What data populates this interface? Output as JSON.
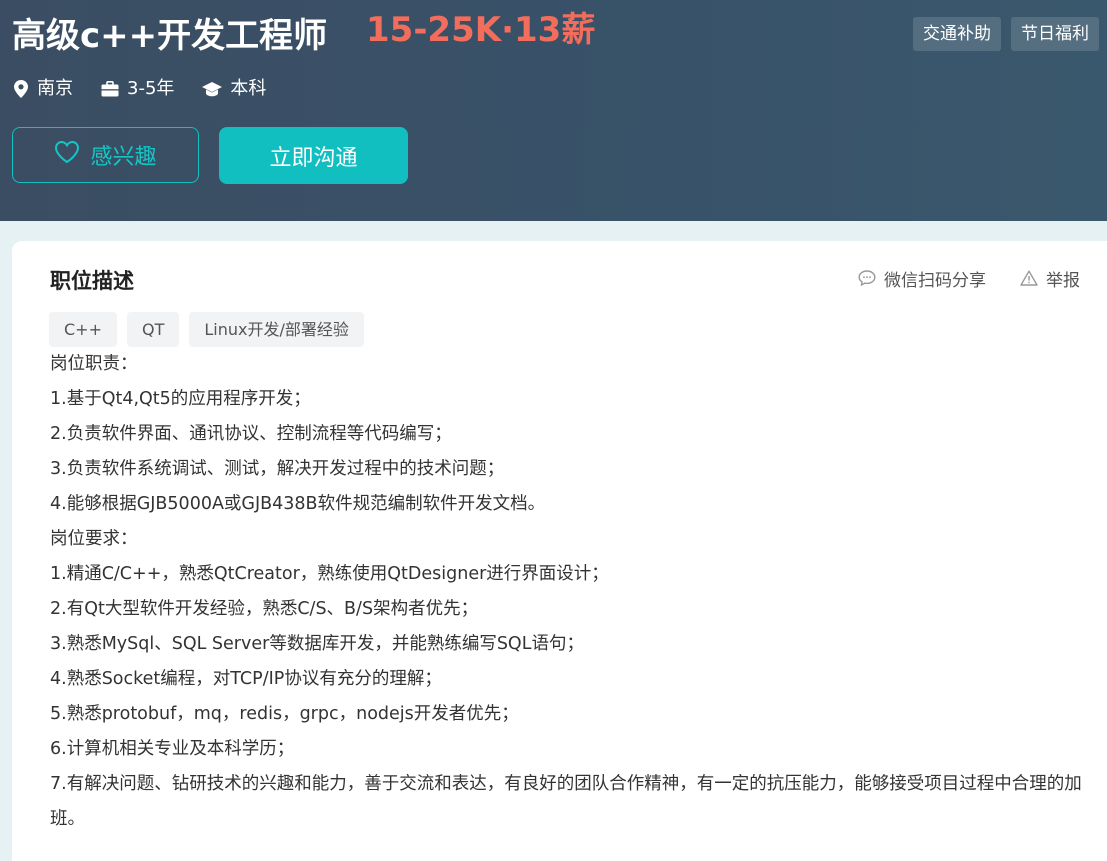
{
  "job": {
    "title": "高级c++开发工程师",
    "salary": "15-25K·13薪",
    "benefits": [
      "交通补助",
      "节日福利"
    ],
    "location": "南京",
    "experience": "3-5年",
    "education": "本科"
  },
  "buttons": {
    "interest": "感兴趣",
    "chat": "立即沟通"
  },
  "description": {
    "section_title": "职位描述",
    "share_label": "微信扫码分享",
    "report_label": "举报",
    "skills": [
      "C++",
      "QT",
      "Linux开发/部署经验"
    ],
    "lines": [
      "岗位职责：",
      "1.基于Qt4,Qt5的应用程序开发；",
      "2.负责软件界面、通讯协议、控制流程等代码编写；",
      "3.负责软件系统调试、测试，解决开发过程中的技术问题；",
      "4.能够根据GJB5000A或GJB438B软件规范编制软件开发文档。",
      "岗位要求：",
      "1.精通C/C++，熟悉QtCreator，熟练使用QtDesigner进行界面设计；",
      "2.有Qt大型软件开发经验，熟悉C/S、B/S架构者优先；",
      "3.熟悉MySql、SQL Server等数据库开发，并能熟练编写SQL语句；",
      "4.熟悉Socket编程，对TCP/IP协议有充分的理解；",
      "5.熟悉protobuf，mq，redis，grpc，nodejs开发者优先；",
      "6.计算机相关专业及本科学历；",
      "7.有解决问题、钻研技术的兴趣和能力，善于交流和表达，有良好的团队合作精神，有一定的抗压能力，能够接受项目过程中合理的加班。"
    ]
  },
  "colors": {
    "header_bg": "#3b4d62",
    "salary": "#f26d5b",
    "accent": "#12bfc0"
  },
  "icons": {
    "location": "location-pin-icon",
    "experience": "briefcase-icon",
    "education": "graduation-cap-icon",
    "interest": "heart-icon",
    "share": "chat-bubble-icon",
    "report": "warning-icon"
  }
}
